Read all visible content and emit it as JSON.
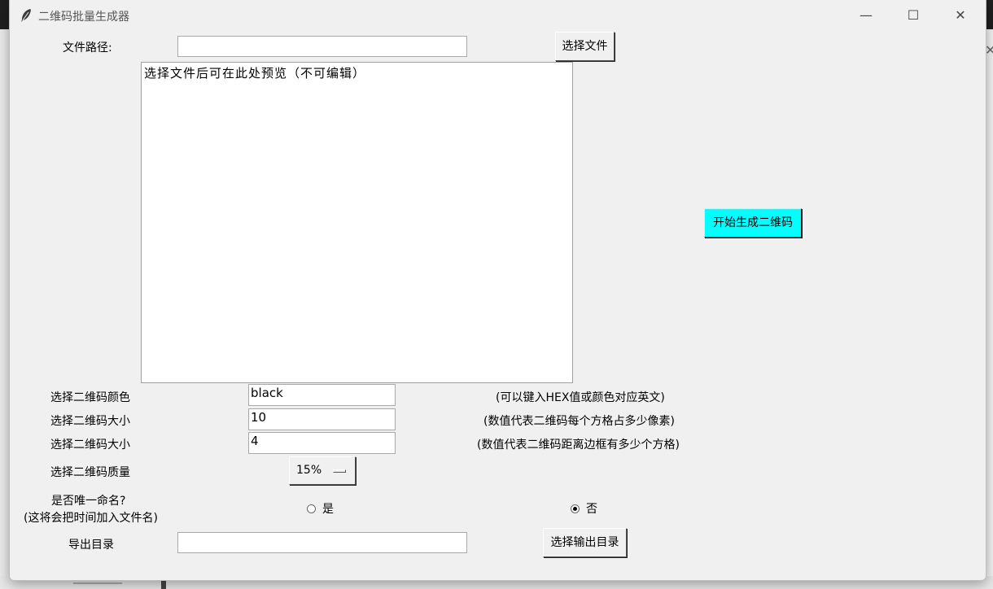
{
  "window": {
    "title": "二维码批量生成器",
    "controls": {
      "minimize": "—",
      "maximize": "☐",
      "close": "✕"
    }
  },
  "file": {
    "label": "文件路径:",
    "path_value": "",
    "choose_button": "选择文件"
  },
  "preview": {
    "text": "选择文件后可在此处预览（不可编辑）"
  },
  "generate_button": "开始生成二维码",
  "generate_color": "#00ffff",
  "options": {
    "color_label": "选择二维码颜色",
    "color_value": "black",
    "color_hint": "(可以键入HEX值或颜色对应英文)",
    "size_label": "选择二维码大小",
    "size_value": "10",
    "size_hint": "(数值代表二维码每个方格占多少像素)",
    "border_label": "选择二维码大小",
    "border_value": "4",
    "border_hint": "(数值代表二维码距离边框有多少个方格)",
    "quality_label": "选择二维码质量",
    "quality_value": "15%"
  },
  "unique_name": {
    "label_line1": "是否唯一命名?",
    "label_line2": "(这将会把时间加入文件名)",
    "yes": "是",
    "no": "否",
    "selected": "否"
  },
  "export": {
    "label": "导出目录",
    "path_value": "",
    "choose_button": "选择输出目录"
  }
}
